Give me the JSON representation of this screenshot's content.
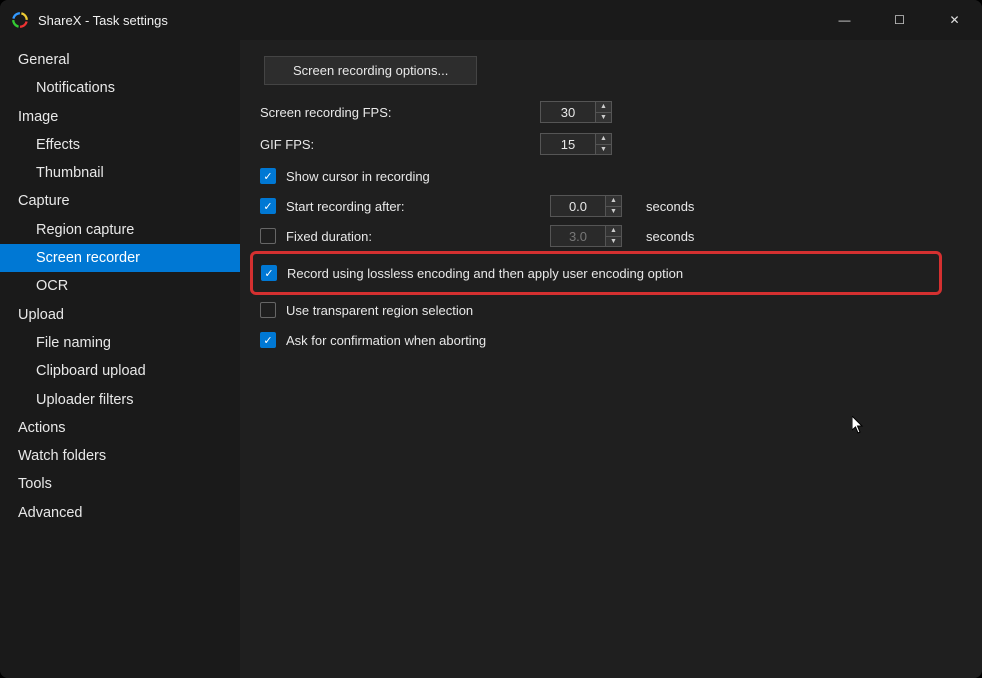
{
  "window": {
    "title": "ShareX - Task settings"
  },
  "winControls": {
    "minimize": "—",
    "maximize": "☐",
    "close": "✕"
  },
  "sidebar": {
    "items": [
      {
        "label": "General",
        "level": 0,
        "selected": false
      },
      {
        "label": "Notifications",
        "level": 1,
        "selected": false
      },
      {
        "label": "Image",
        "level": 0,
        "selected": false
      },
      {
        "label": "Effects",
        "level": 1,
        "selected": false
      },
      {
        "label": "Thumbnail",
        "level": 1,
        "selected": false
      },
      {
        "label": "Capture",
        "level": 0,
        "selected": false
      },
      {
        "label": "Region capture",
        "level": 1,
        "selected": false
      },
      {
        "label": "Screen recorder",
        "level": 1,
        "selected": true
      },
      {
        "label": "OCR",
        "level": 1,
        "selected": false
      },
      {
        "label": "Upload",
        "level": 0,
        "selected": false
      },
      {
        "label": "File naming",
        "level": 1,
        "selected": false
      },
      {
        "label": "Clipboard upload",
        "level": 1,
        "selected": false
      },
      {
        "label": "Uploader filters",
        "level": 1,
        "selected": false
      },
      {
        "label": "Actions",
        "level": 0,
        "selected": false
      },
      {
        "label": "Watch folders",
        "level": 0,
        "selected": false
      },
      {
        "label": "Tools",
        "level": 0,
        "selected": false
      },
      {
        "label": "Advanced",
        "level": 0,
        "selected": false
      }
    ]
  },
  "main": {
    "optionsBtn": "Screen recording options...",
    "fpsLabel": "Screen recording FPS:",
    "fpsValue": "30",
    "gifLabel": "GIF FPS:",
    "gifValue": "15",
    "showCursor": {
      "checked": true,
      "label": "Show cursor in recording"
    },
    "startAfter": {
      "checked": true,
      "label": "Start recording after:",
      "value": "0.0",
      "unit": "seconds"
    },
    "fixedDuration": {
      "checked": false,
      "label": "Fixed duration:",
      "value": "3.0",
      "unit": "seconds"
    },
    "lossless": {
      "checked": true,
      "label": "Record using lossless encoding and then apply user encoding option"
    },
    "transparent": {
      "checked": false,
      "label": "Use transparent region selection"
    },
    "askConfirm": {
      "checked": true,
      "label": "Ask for confirmation when aborting"
    }
  },
  "colors": {
    "accent": "#0078d4",
    "highlight": "#d43030"
  }
}
